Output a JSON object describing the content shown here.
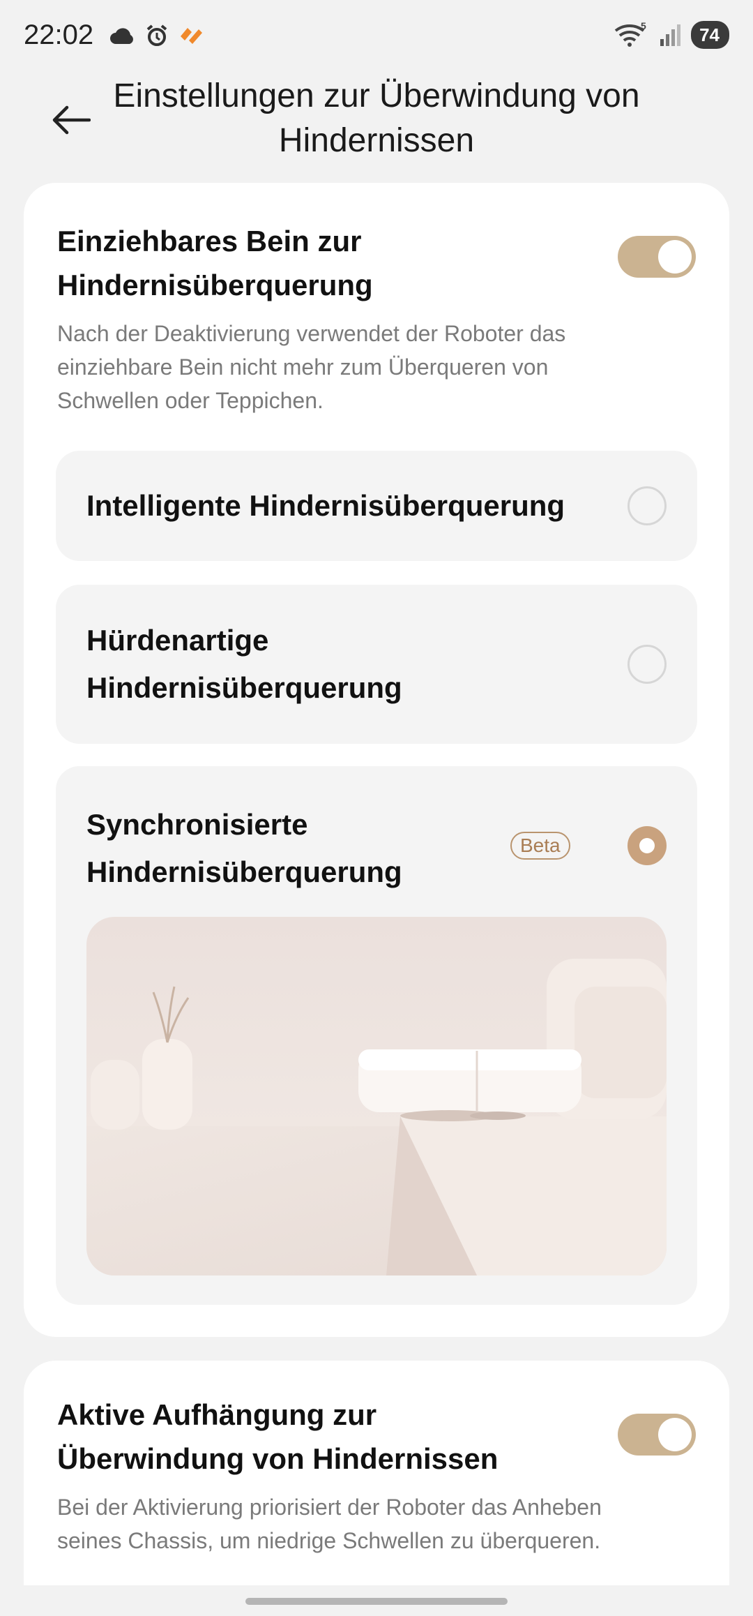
{
  "status_bar": {
    "time": "22:02",
    "left_icons": [
      "cloud-icon",
      "alarm-icon",
      "app-notification-icon"
    ],
    "wifi_badge": "5",
    "battery": "74"
  },
  "header": {
    "back_icon": "arrow-left-icon",
    "title": "Einstellungen zur Überwindung von Hindernissen"
  },
  "retractable_leg": {
    "title": "Einziehbares Bein zur Hindernisüberquerung",
    "description": "Nach der Deaktivierung verwendet der Roboter das einziehbare Bein nicht mehr zum Überqueren von Schwellen oder Teppichen.",
    "enabled": true,
    "options": [
      {
        "label": "Intelligente Hindernisüberquerung",
        "selected": false
      },
      {
        "label": "Hürdenartige Hindernisüberquerung",
        "selected": false
      },
      {
        "label": "Synchronisierte Hindernisüberquerung",
        "badge": "Beta",
        "selected": true
      }
    ]
  },
  "active_suspension": {
    "title": "Aktive Aufhängung zur Überwindung von Hindernissen",
    "description": "Bei der Aktivierung priorisiert der Roboter das Anheben seines Chassis, um niedrige Schwellen zu überqueren.",
    "enabled": true
  },
  "colors": {
    "accent": "#cbb391",
    "radio_selected": "#c9a27e",
    "beta_text": "#a97d54",
    "card_bg": "#ffffff",
    "option_bg": "#f4f4f4",
    "page_bg": "#f2f2f2"
  }
}
